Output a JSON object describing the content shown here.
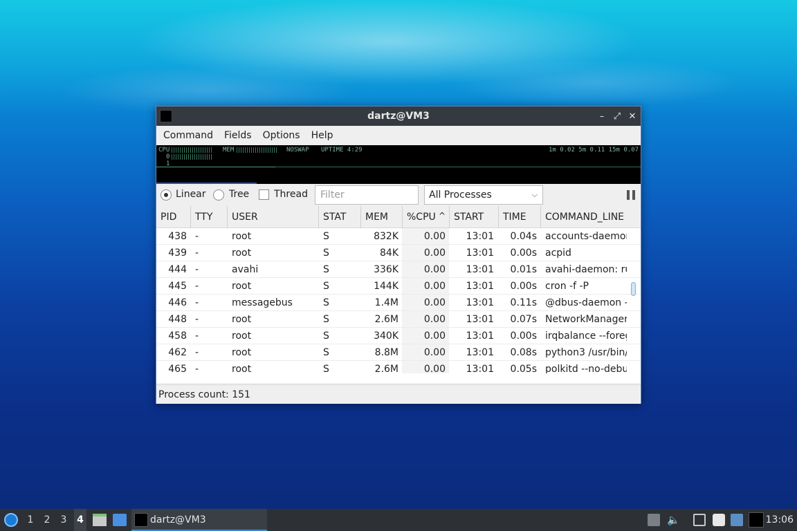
{
  "window": {
    "title": "dartz@VM3",
    "controls": {
      "minimize": "–",
      "restore": "⤢",
      "close": "✕"
    }
  },
  "menu": [
    "Command",
    "Fields",
    "Options",
    "Help"
  ],
  "meter": {
    "cpu": "CPU",
    "cpu_small": "0",
    "cpu_small2": "1",
    "mem": "MEM",
    "noswap": "NOSWAP",
    "uptime": "UPTIME 4:29",
    "load": "1m 0.02  5m 0.11  15m 0.07"
  },
  "toolbar": {
    "linear": "Linear",
    "tree": "Tree",
    "thread": "Thread",
    "filter_placeholder": "Filter",
    "process_select": "All Processes"
  },
  "columns": [
    "PID",
    "TTY",
    "USER",
    "STAT",
    "MEM",
    "%CPU",
    "START",
    "TIME",
    "COMMAND_LINE"
  ],
  "sort_indicator": "^",
  "rows": [
    {
      "pid": "438",
      "tty": "-",
      "user": "root",
      "stat": "S",
      "mem": "832K",
      "cpu": "0.00",
      "start": "13:01",
      "time": "0.04s",
      "cmd": "accounts-daemon"
    },
    {
      "pid": "439",
      "tty": "-",
      "user": "root",
      "stat": "S",
      "mem": "84K",
      "cpu": "0.00",
      "start": "13:01",
      "time": "0.00s",
      "cmd": "acpid"
    },
    {
      "pid": "444",
      "tty": "-",
      "user": "avahi",
      "stat": "S",
      "mem": "336K",
      "cpu": "0.00",
      "start": "13:01",
      "time": "0.01s",
      "cmd": "avahi-daemon: ru"
    },
    {
      "pid": "445",
      "tty": "-",
      "user": "root",
      "stat": "S",
      "mem": "144K",
      "cpu": "0.00",
      "start": "13:01",
      "time": "0.00s",
      "cmd": "cron -f -P"
    },
    {
      "pid": "446",
      "tty": "-",
      "user": "messagebus",
      "stat": "S",
      "mem": "1.4M",
      "cpu": "0.00",
      "start": "13:01",
      "time": "0.11s",
      "cmd": "@dbus-daemon --"
    },
    {
      "pid": "448",
      "tty": "-",
      "user": "root",
      "stat": "S",
      "mem": "2.6M",
      "cpu": "0.00",
      "start": "13:01",
      "time": "0.07s",
      "cmd": "NetworkManager"
    },
    {
      "pid": "458",
      "tty": "-",
      "user": "root",
      "stat": "S",
      "mem": "340K",
      "cpu": "0.00",
      "start": "13:01",
      "time": "0.00s",
      "cmd": "irqbalance --foreg"
    },
    {
      "pid": "462",
      "tty": "-",
      "user": "root",
      "stat": "S",
      "mem": "8.8M",
      "cpu": "0.00",
      "start": "13:01",
      "time": "0.08s",
      "cmd": "python3 /usr/bin/"
    },
    {
      "pid": "465",
      "tty": "-",
      "user": "root",
      "stat": "S",
      "mem": "2.6M",
      "cpu": "0.00",
      "start": "13:01",
      "time": "0.05s",
      "cmd": "polkitd --no-debu"
    }
  ],
  "status": "Process count: 151",
  "taskbar": {
    "workspaces": [
      "1",
      "2",
      "3",
      "4"
    ],
    "task_label": "dartz@VM3",
    "clock": "13:06"
  },
  "colors": {
    "accent": "#3f86d6",
    "titlebar": "#343a40",
    "taskbar": "#2d3136"
  }
}
